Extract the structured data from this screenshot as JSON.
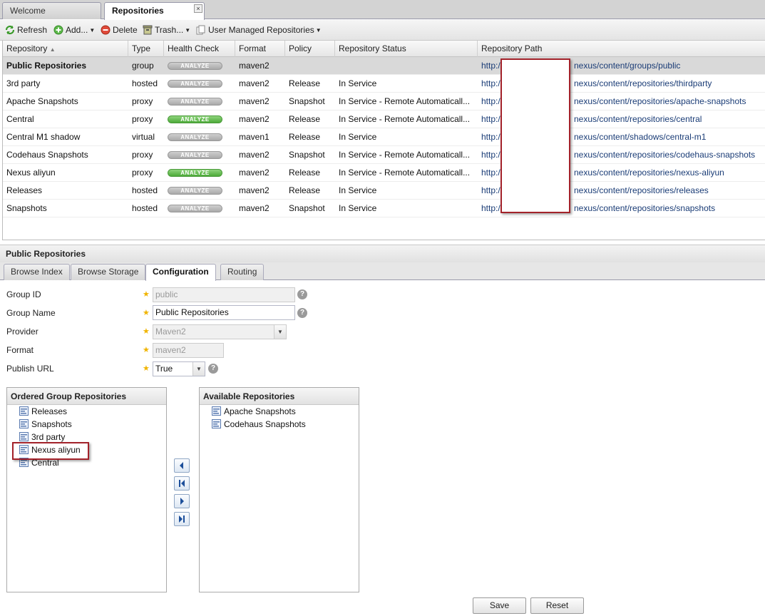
{
  "tabs": [
    {
      "label": "Welcome",
      "active": false
    },
    {
      "label": "Repositories",
      "active": true,
      "close": "×"
    }
  ],
  "toolbar": {
    "refresh": "Refresh",
    "add": "Add...",
    "delete": "Delete",
    "trash": "Trash...",
    "user_managed": "User Managed Repositories"
  },
  "grid": {
    "columns": [
      "Repository",
      "Type",
      "Health Check",
      "Format",
      "Policy",
      "Repository Status",
      "Repository Path"
    ],
    "sort_indicator": "▲",
    "analyze_label": "ANALYZE",
    "rows": [
      {
        "name": "Public Repositories",
        "type": "group",
        "health": "grey",
        "format": "maven2",
        "policy": "",
        "status": "",
        "path_prefix": "http:/",
        "path_suffix": "nexus/content/groups/public",
        "selected": true
      },
      {
        "name": "3rd party",
        "type": "hosted",
        "health": "grey",
        "format": "maven2",
        "policy": "Release",
        "status": "In Service",
        "path_prefix": "http:/",
        "path_suffix": "nexus/content/repositories/thirdparty"
      },
      {
        "name": "Apache Snapshots",
        "type": "proxy",
        "health": "grey",
        "format": "maven2",
        "policy": "Snapshot",
        "status": "In Service - Remote Automaticall...",
        "path_prefix": "http:/",
        "path_suffix": "nexus/content/repositories/apache-snapshots"
      },
      {
        "name": "Central",
        "type": "proxy",
        "health": "green",
        "format": "maven2",
        "policy": "Release",
        "status": "In Service - Remote Automaticall...",
        "path_prefix": "http:/",
        "path_suffix": "nexus/content/repositories/central"
      },
      {
        "name": "Central M1 shadow",
        "type": "virtual",
        "health": "grey",
        "format": "maven1",
        "policy": "Release",
        "status": "In Service",
        "path_prefix": "http:/",
        "path_suffix": "nexus/content/shadows/central-m1"
      },
      {
        "name": "Codehaus Snapshots",
        "type": "proxy",
        "health": "grey",
        "format": "maven2",
        "policy": "Snapshot",
        "status": "In Service - Remote Automaticall...",
        "path_prefix": "http:/",
        "path_suffix": "nexus/content/repositories/codehaus-snapshots"
      },
      {
        "name": "Nexus aliyun",
        "type": "proxy",
        "health": "green",
        "format": "maven2",
        "policy": "Release",
        "status": "In Service - Remote Automaticall...",
        "path_prefix": "http:/",
        "path_suffix": "nexus/content/repositories/nexus-aliyun"
      },
      {
        "name": "Releases",
        "type": "hosted",
        "health": "grey",
        "format": "maven2",
        "policy": "Release",
        "status": "In Service",
        "path_prefix": "http:/",
        "path_suffix": "nexus/content/repositories/releases"
      },
      {
        "name": "Snapshots",
        "type": "hosted",
        "health": "grey",
        "format": "maven2",
        "policy": "Snapshot",
        "status": "In Service",
        "path_prefix": "http:/",
        "path_suffix": "nexus/content/repositories/snapshots"
      }
    ]
  },
  "detail": {
    "title": "Public Repositories",
    "tabs": [
      "Browse Index",
      "Browse Storage",
      "Configuration",
      "Routing"
    ],
    "active_tab": "Configuration",
    "form": {
      "group_id": {
        "label": "Group ID",
        "value": "public"
      },
      "group_name": {
        "label": "Group Name",
        "value": "Public Repositories"
      },
      "provider": {
        "label": "Provider",
        "value": "Maven2"
      },
      "format": {
        "label": "Format",
        "value": "maven2"
      },
      "publish_url": {
        "label": "Publish URL",
        "value": "True"
      }
    },
    "ordered": {
      "title": "Ordered Group Repositories",
      "items": [
        "Releases",
        "Snapshots",
        "3rd party",
        "Nexus aliyun",
        "Central"
      ],
      "highlighted": "Nexus aliyun"
    },
    "available": {
      "title": "Available Repositories",
      "items": [
        "Apache Snapshots",
        "Codehaus Snapshots"
      ]
    },
    "buttons": {
      "save": "Save",
      "reset": "Reset"
    }
  },
  "colors": {
    "accent_red": "#a3222a",
    "analyze_green": "#4caa38",
    "path_link": "#1a3c76"
  }
}
